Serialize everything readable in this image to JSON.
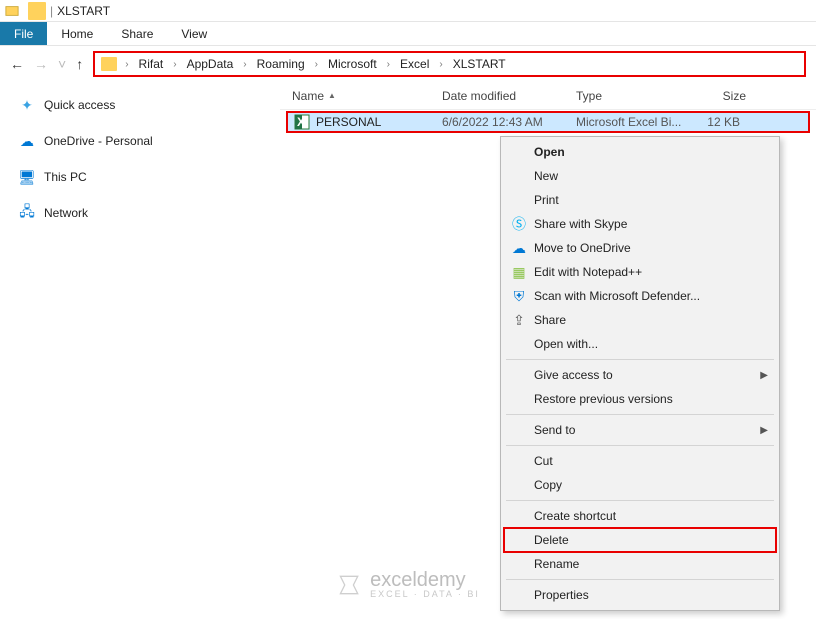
{
  "window": {
    "title": "XLSTART"
  },
  "tabs": {
    "file": "File",
    "home": "Home",
    "share": "Share",
    "view": "View"
  },
  "breadcrumb": [
    "Rifat",
    "AppData",
    "Roaming",
    "Microsoft",
    "Excel",
    "XLSTART"
  ],
  "sidebar": [
    {
      "label": "Quick access",
      "icon": "star"
    },
    {
      "label": "OneDrive - Personal",
      "icon": "cloud"
    },
    {
      "label": "This PC",
      "icon": "pc"
    },
    {
      "label": "Network",
      "icon": "net"
    }
  ],
  "columns": {
    "name": "Name",
    "date": "Date modified",
    "type": "Type",
    "size": "Size"
  },
  "file": {
    "name": "PERSONAL",
    "date": "6/6/2022 12:43 AM",
    "type": "Microsoft Excel Bi...",
    "size": "12 KB"
  },
  "context_menu": [
    {
      "label": "Open",
      "bold": true
    },
    {
      "label": "New"
    },
    {
      "label": "Print"
    },
    {
      "label": "Share with Skype",
      "icon": "skype"
    },
    {
      "label": "Move to OneDrive",
      "icon": "cloud"
    },
    {
      "label": "Edit with Notepad++",
      "icon": "notepad"
    },
    {
      "label": "Scan with Microsoft Defender...",
      "icon": "shield"
    },
    {
      "label": "Share",
      "icon": "share"
    },
    {
      "label": "Open with...",
      "sep_after": true
    },
    {
      "label": "Give access to",
      "submenu": true
    },
    {
      "label": "Restore previous versions",
      "sep_after": true
    },
    {
      "label": "Send to",
      "submenu": true,
      "sep_after": true
    },
    {
      "label": "Cut"
    },
    {
      "label": "Copy",
      "sep_after": true
    },
    {
      "label": "Create shortcut"
    },
    {
      "label": "Delete",
      "highlight": true
    },
    {
      "label": "Rename",
      "sep_after": true
    },
    {
      "label": "Properties"
    }
  ],
  "watermark": {
    "main": "exceldemy",
    "sub": "EXCEL · DATA · BI"
  }
}
